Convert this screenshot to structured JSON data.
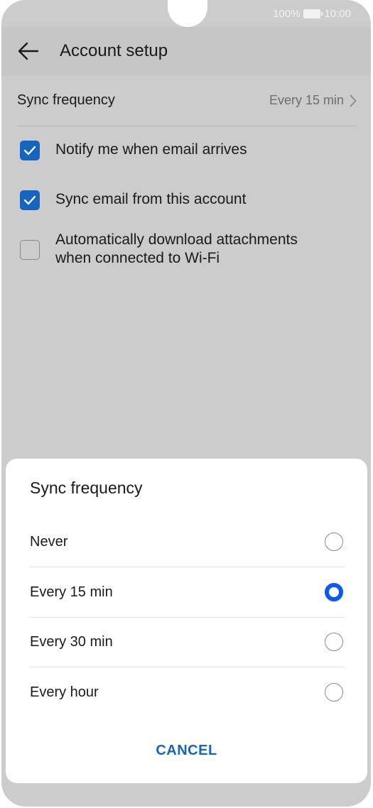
{
  "status": {
    "battery_pct": "100%",
    "time": "10:00"
  },
  "appbar": {
    "title": "Account setup",
    "back_icon": "arrow-left-icon"
  },
  "settings": {
    "sync_label": "Sync frequency",
    "sync_value": "Every 15 min",
    "checks": [
      {
        "label": "Notify me when email arrives",
        "checked": true
      },
      {
        "label": "Sync email from this account",
        "checked": true
      },
      {
        "label": "Automatically download attachments",
        "label2": "when connected to Wi-Fi",
        "checked": false
      }
    ]
  },
  "dialog": {
    "title": "Sync frequency",
    "options": [
      {
        "label": "Never",
        "selected": false
      },
      {
        "label": "Every 15 min",
        "selected": true
      },
      {
        "label": "Every 30 min",
        "selected": false
      },
      {
        "label": "Every hour",
        "selected": false
      }
    ],
    "cancel_label": "CANCEL"
  },
  "colors": {
    "accent": "#1565c0",
    "radio_selected": "#0a59f7",
    "scrim": "#cccccc"
  }
}
